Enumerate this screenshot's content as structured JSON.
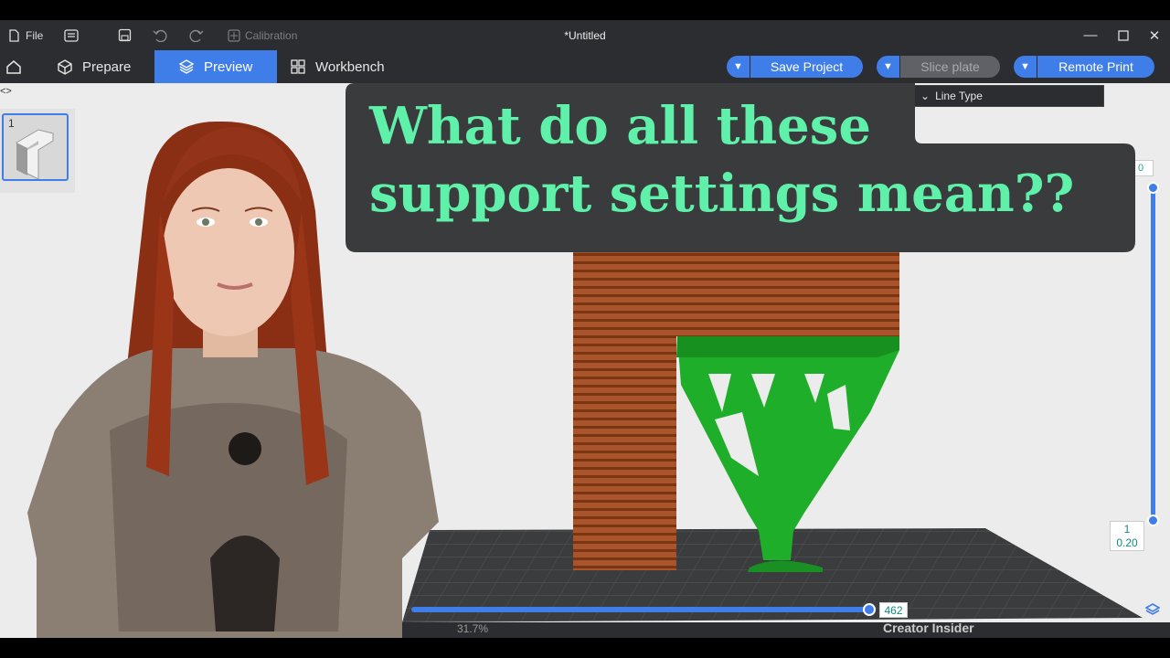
{
  "titlebar": {
    "file_label": "File",
    "calibration_label": "Calibration",
    "window_title": "*Untitled"
  },
  "nav": {
    "tabs": [
      {
        "label": "Prepare"
      },
      {
        "label": "Preview"
      },
      {
        "label": "Workbench"
      }
    ],
    "active_tab": "Preview",
    "save_project_label": "Save Project",
    "slice_plate_label": "Slice plate",
    "remote_print_label": "Remote Print"
  },
  "plate": {
    "number": "1"
  },
  "legend": {
    "line_type_label": "Line Type"
  },
  "vertical_slider": {
    "top_value_partial": "0",
    "bottom_layer": "1",
    "bottom_height": "0.20"
  },
  "horizontal_slider": {
    "value": "462"
  },
  "bottom_strip": {
    "percent_text": "31.7%",
    "partial_text": "Creator Insider"
  },
  "caption": {
    "line1": "What do all these",
    "line2": "support settings mean??"
  },
  "colors": {
    "accent": "#3f7de9",
    "caption_text": "#5ff0a9",
    "wall": "#a9542b",
    "support": "#1fae2a",
    "ui_dark": "#2b2d30"
  }
}
